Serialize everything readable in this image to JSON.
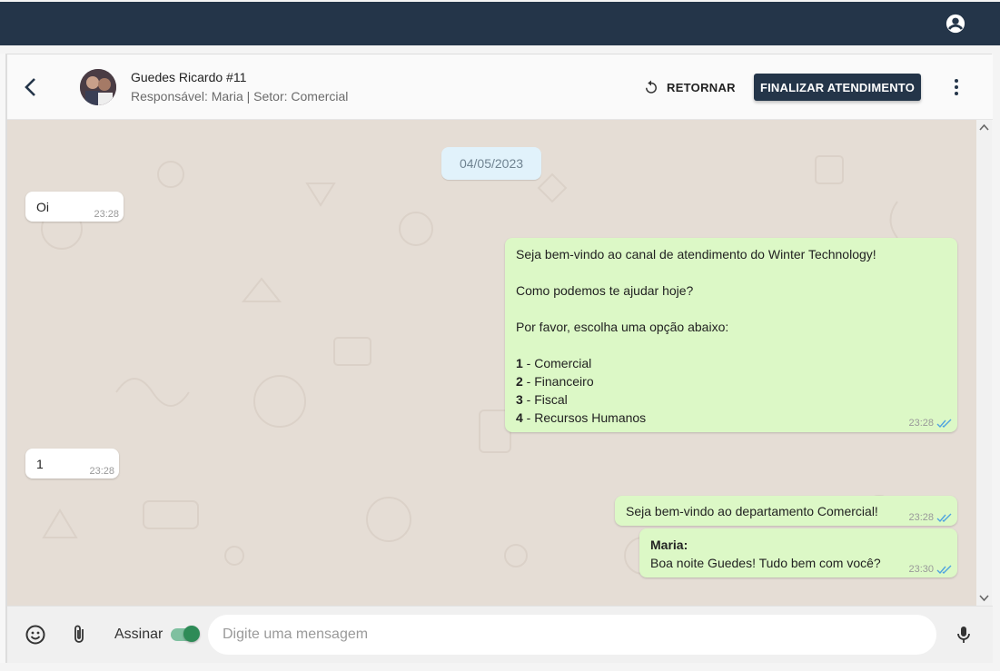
{
  "header": {
    "contact_name": "Guedes Ricardo #11",
    "contact_sub": "Responsável: Maria | Setor: Comercial",
    "retornar_label": "RETORNAR",
    "finalizar_label": "FINALIZAR ATENDIMENTO"
  },
  "chat": {
    "date": "04/05/2023",
    "messages": [
      {
        "dir": "in",
        "text": "Oi",
        "time": "23:28"
      },
      {
        "dir": "out",
        "lines": [
          "Seja bem-vindo ao canal de atendimento do Winter Technology!",
          "",
          "Como podemos te ajudar hoje?",
          "",
          "Por favor, escolha uma opção abaixo:",
          "",
          "1 - Comercial",
          "2 - Financeiro",
          "3 - Fiscal",
          "4 - Recursos Humanos"
        ],
        "options": [
          {
            "num": "1",
            "label": " - Comercial"
          },
          {
            "num": "2",
            "label": " - Financeiro"
          },
          {
            "num": "3",
            "label": " - Fiscal"
          },
          {
            "num": "4",
            "label": " - Recursos Humanos"
          }
        ],
        "time": "23:28",
        "read": true
      },
      {
        "dir": "in",
        "text": "1",
        "time": "23:28"
      },
      {
        "dir": "out",
        "text": "Seja bem-vindo ao departamento Comercial!",
        "time": "23:28",
        "read": true
      },
      {
        "dir": "out",
        "author": "Maria:",
        "text": "Boa noite Guedes! Tudo bem com você?",
        "time": "23:30",
        "read": true
      }
    ]
  },
  "composer": {
    "assinar_label": "Assinar",
    "assinar_on": true,
    "placeholder": "Digite uma mensagem"
  },
  "colors": {
    "topbar": "#243549",
    "out_bubble": "#dcf8c6",
    "chat_bg": "#e5ddd5",
    "toggle": "#2e8b57"
  },
  "icons": [
    "account-circle-icon",
    "arrow-back-icon",
    "undo-icon",
    "more-vert-icon",
    "emoji-icon",
    "attach-icon",
    "mic-icon",
    "double-check-icon"
  ]
}
